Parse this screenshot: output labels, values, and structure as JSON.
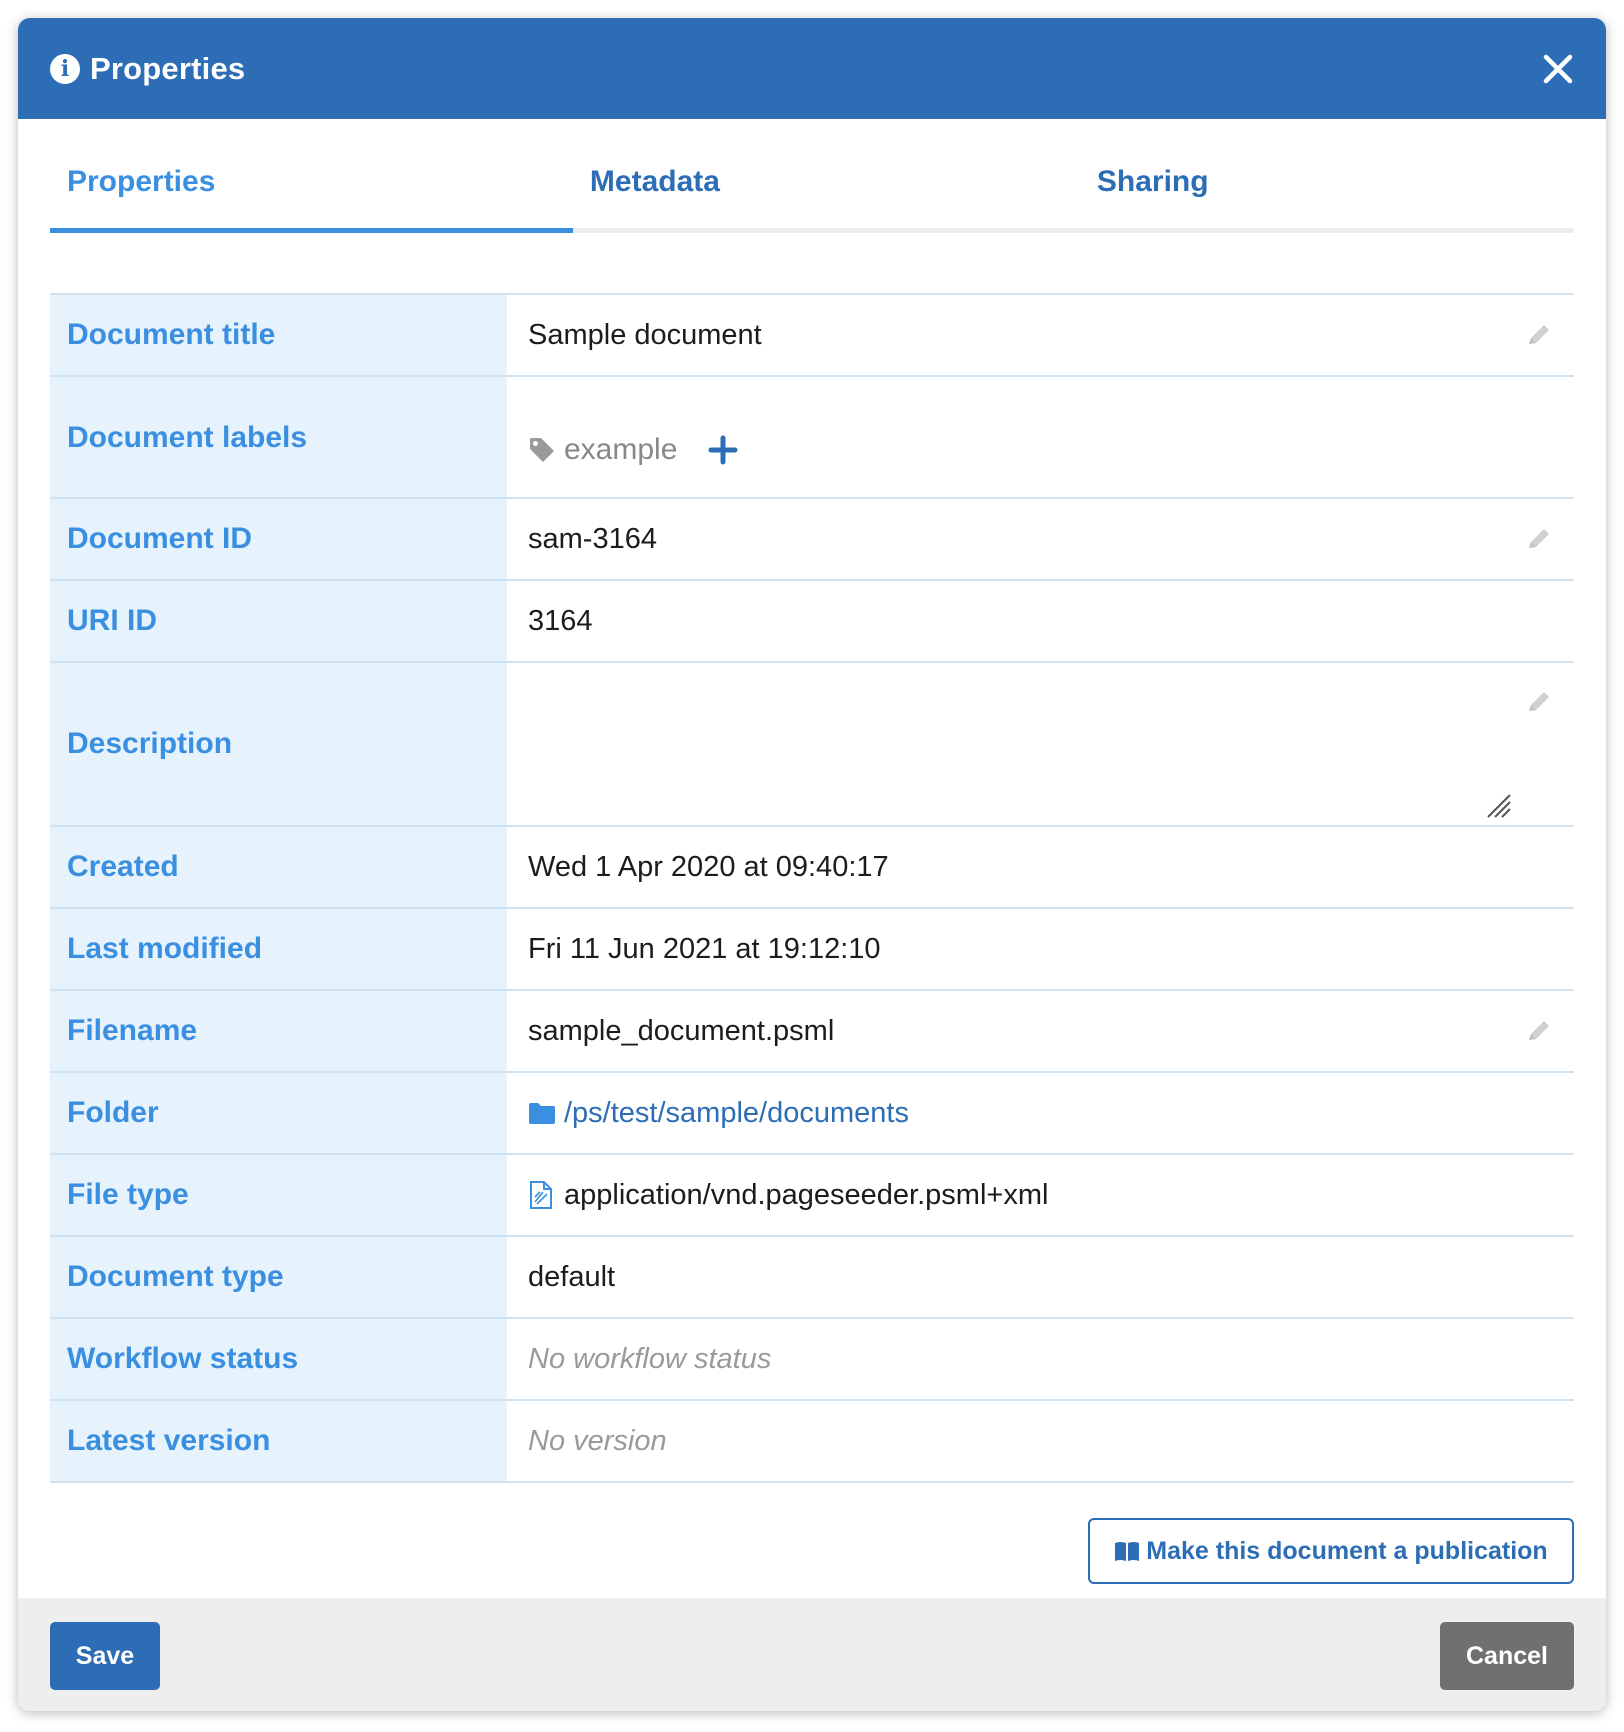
{
  "dialog": {
    "title": "Properties",
    "close_icon": "close-icon",
    "info_icon": "info-icon"
  },
  "tabs": [
    {
      "label": "Properties",
      "active": true
    },
    {
      "label": "Metadata",
      "active": false
    },
    {
      "label": "Sharing",
      "active": false
    }
  ],
  "rows": {
    "document_title": {
      "label": "Document title",
      "value": "Sample document"
    },
    "document_labels": {
      "label": "Document labels",
      "tag": "example"
    },
    "document_id": {
      "label": "Document ID",
      "value": "sam-3164"
    },
    "uri_id": {
      "label": "URI ID",
      "value": "3164"
    },
    "description": {
      "label": "Description",
      "value": ""
    },
    "created": {
      "label": "Created",
      "value": "Wed 1 Apr 2020 at 09:40:17"
    },
    "last_modified": {
      "label": "Last modified",
      "value": "Fri 11 Jun 2021 at 19:12:10"
    },
    "filename": {
      "label": "Filename",
      "value": "sample_document.psml"
    },
    "folder": {
      "label": "Folder",
      "value": "/ps/test/sample/documents"
    },
    "file_type": {
      "label": "File type",
      "value": "application/vnd.pageseeder.psml+xml"
    },
    "document_type": {
      "label": "Document type",
      "value": "default"
    },
    "workflow_status": {
      "label": "Workflow status",
      "value": "No workflow status"
    },
    "latest_version": {
      "label": "Latest version",
      "value": "No version"
    }
  },
  "actions": {
    "publication_label": "Make this document a publication",
    "save_label": "Save",
    "cancel_label": "Cancel"
  },
  "colors": {
    "header": "#2c6db5",
    "label_text": "#3b8fe0",
    "label_bg": "#e7f3fc",
    "footer_bg": "#eeeeee",
    "cancel_bg": "#707070"
  }
}
